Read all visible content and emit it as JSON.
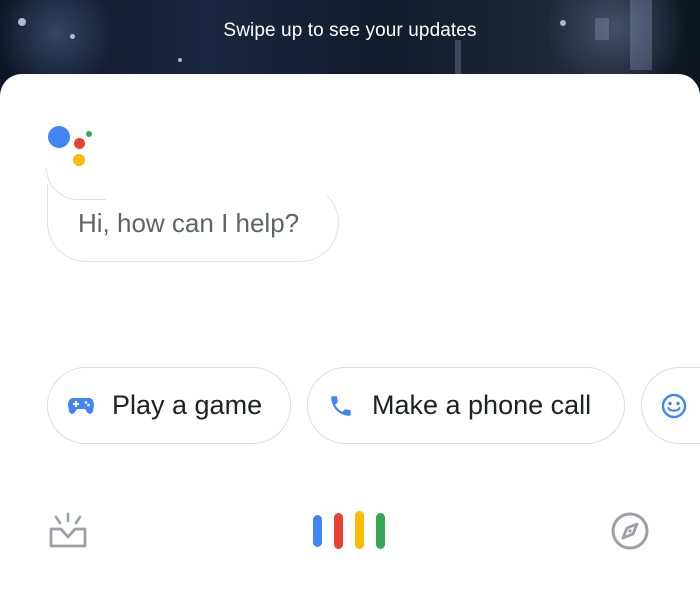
{
  "header": {
    "swipe_hint": "Swipe up to see your updates"
  },
  "assistant": {
    "greeting": "Hi, how can I help?",
    "logo_colors": [
      "#4285F4",
      "#EA4335",
      "#FBBC05",
      "#34A853"
    ]
  },
  "suggestions": [
    {
      "label": "Play a game",
      "icon": "gamepad-icon"
    },
    {
      "label": "Make a phone call",
      "icon": "phone-icon"
    },
    {
      "label": "",
      "icon": "smiley-icon"
    }
  ],
  "bottom_bar": {
    "left_icon": "updates-tray-icon",
    "center_icon": "mic-bars-icon",
    "right_icon": "compass-icon"
  },
  "colors": {
    "blue": "#4285F4",
    "red": "#EA4335",
    "yellow": "#FBBC05",
    "green": "#34A853",
    "icon_gray": "#9aa0a6"
  }
}
